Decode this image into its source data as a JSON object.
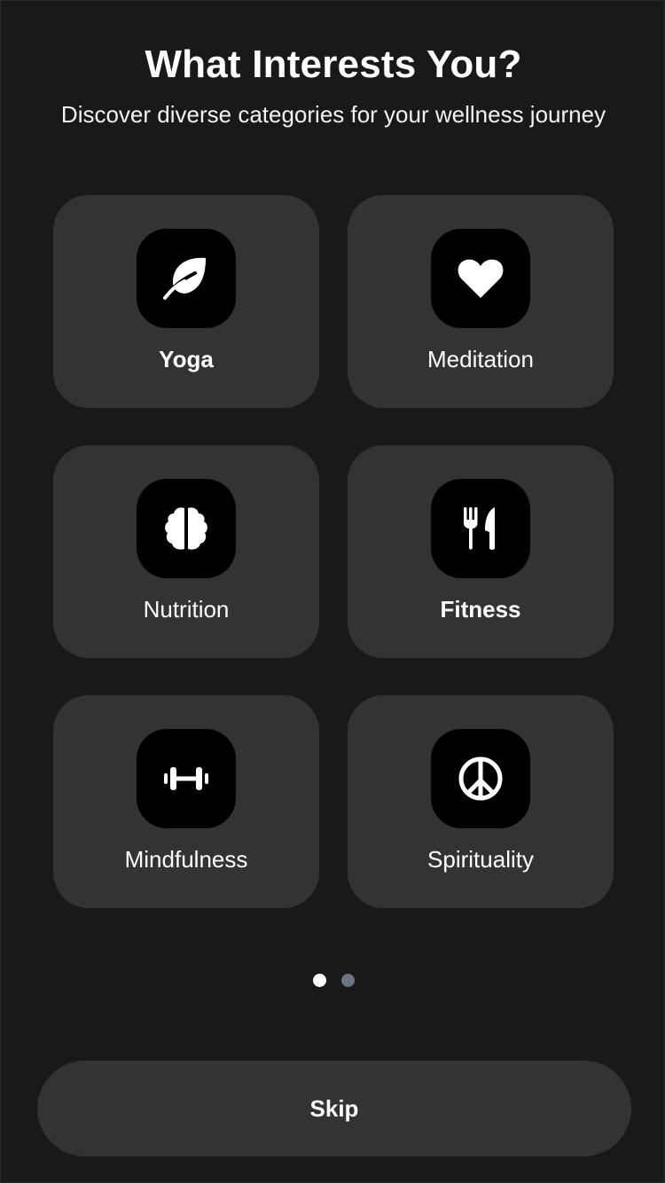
{
  "header": {
    "title": "What Interests You?",
    "subtitle": "Discover diverse categories for your wellness journey"
  },
  "categories": [
    {
      "label": "Yoga",
      "icon": "leaf-icon",
      "selected": true
    },
    {
      "label": "Meditation",
      "icon": "heart-icon",
      "selected": false
    },
    {
      "label": "Nutrition",
      "icon": "brain-icon",
      "selected": false
    },
    {
      "label": "Fitness",
      "icon": "utensils-icon",
      "selected": true
    },
    {
      "label": "Mindfulness",
      "icon": "dumbbell-icon",
      "selected": false
    },
    {
      "label": "Spirituality",
      "icon": "peace-icon",
      "selected": false
    }
  ],
  "pagination": {
    "pages": 2,
    "current": 1
  },
  "footer": {
    "skip_label": "Skip"
  },
  "colors": {
    "background": "#191919",
    "card": "#333333",
    "icon_tile": "#000000",
    "dot_active": "#ffffff",
    "dot_inactive": "#6b7280"
  }
}
